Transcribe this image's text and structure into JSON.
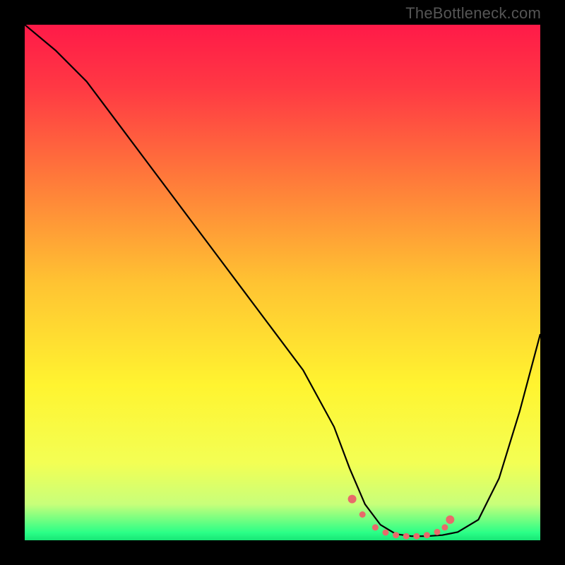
{
  "watermark": "TheBottleneck.com",
  "chart_data": {
    "type": "line",
    "title": "",
    "xlabel": "",
    "ylabel": "",
    "xlim": [
      0,
      100
    ],
    "ylim": [
      0,
      100
    ],
    "background_gradient": {
      "stops": [
        {
          "pos": 0.0,
          "color": "#ff1a48"
        },
        {
          "pos": 0.12,
          "color": "#ff3844"
        },
        {
          "pos": 0.3,
          "color": "#ff7a3a"
        },
        {
          "pos": 0.5,
          "color": "#ffc332"
        },
        {
          "pos": 0.7,
          "color": "#fff430"
        },
        {
          "pos": 0.85,
          "color": "#f3ff54"
        },
        {
          "pos": 0.93,
          "color": "#c8ff7a"
        },
        {
          "pos": 0.985,
          "color": "#2bff87"
        },
        {
          "pos": 1.0,
          "color": "#17e676"
        }
      ]
    },
    "series": [
      {
        "name": "bottleneck-curve",
        "color": "#000000",
        "x": [
          0,
          6,
          12,
          18,
          24,
          30,
          36,
          42,
          48,
          54,
          60,
          63,
          66,
          69,
          72,
          75,
          78,
          81,
          84,
          88,
          92,
          96,
          100
        ],
        "y": [
          100,
          95,
          89,
          81,
          73,
          65,
          57,
          49,
          41,
          33,
          22,
          14,
          7,
          3,
          1.2,
          0.8,
          0.8,
          1.0,
          1.6,
          4,
          12,
          25,
          40
        ]
      }
    ],
    "markers": {
      "name": "optimal-range",
      "color": "#e86a6a",
      "points_x": [
        63.5,
        65.5,
        68,
        70,
        72,
        74,
        76,
        78,
        80,
        81.5,
        82.5
      ],
      "points_y": [
        8,
        5,
        2.5,
        1.5,
        1.0,
        0.8,
        0.8,
        1.0,
        1.6,
        2.5,
        4.0
      ]
    }
  }
}
